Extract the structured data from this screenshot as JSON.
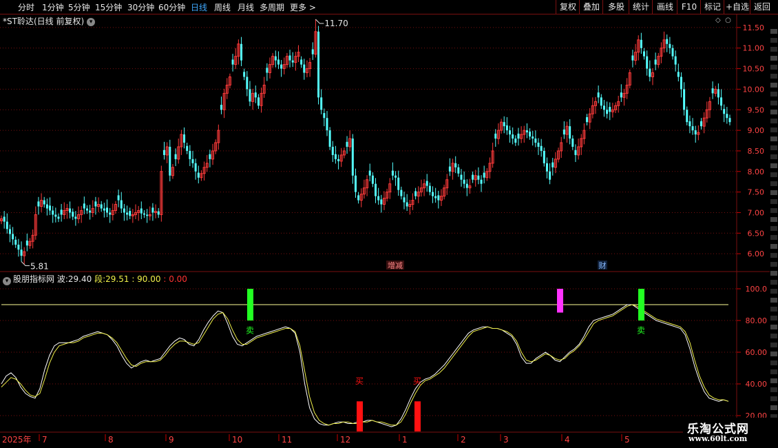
{
  "toolbar": {
    "periods": [
      {
        "label": "分时",
        "active": false
      },
      {
        "label": "1分钟",
        "active": false
      },
      {
        "label": "5分钟",
        "active": false
      },
      {
        "label": "15分钟",
        "active": false
      },
      {
        "label": "30分钟",
        "active": false
      },
      {
        "label": "60分钟",
        "active": false
      },
      {
        "label": "日线",
        "active": true
      },
      {
        "label": "周线",
        "active": false
      },
      {
        "label": "月线",
        "active": false
      },
      {
        "label": "多周期",
        "active": false
      },
      {
        "label": "更多 >",
        "active": false
      }
    ],
    "buttons": [
      "复权",
      "叠加",
      "多股",
      "统计",
      "画线",
      "F10",
      "标记",
      "+自选",
      "返回"
    ]
  },
  "stock": {
    "title": "*ST聆达(日线 前复权)"
  },
  "price_axis": {
    "ticks": [
      "11.50",
      "11.00",
      "10.50",
      "10.00",
      "9.50",
      "9.00",
      "8.50",
      "8.00",
      "7.50",
      "7.00",
      "6.50",
      "6.00"
    ]
  },
  "annotations": {
    "high": "11.70",
    "low": "5.81",
    "event_tag_1": "增减",
    "event_tag_2": "财"
  },
  "indicator": {
    "name": "股朋指标网",
    "wave_label": "波:",
    "wave_value": "29.40",
    "seg_label": "段:",
    "seg_value": "29.51",
    "extra_value": ": 90.00",
    "extra_value2": ": 0.00",
    "axis_ticks": [
      "100.0",
      "80.00",
      "60.00",
      "40.00",
      "20.00"
    ],
    "buy_label": "买",
    "sell_label": "卖"
  },
  "date_axis": {
    "year": "2025年",
    "months": [
      "7",
      "8",
      "9",
      "10",
      "11",
      "12",
      "1",
      "2",
      "3",
      "4",
      "5"
    ]
  },
  "watermark": {
    "name": "乐淘公式网",
    "url": "www.60lt.com"
  },
  "colors": {
    "up": "#ff3b3b",
    "down": "#54ffff",
    "ind_white": "#ffffff",
    "ind_yellow": "#f0f04a",
    "buy": "#ff1111",
    "sell": "#22ff22",
    "warn": "#ff33ff",
    "grid": "#7a1010"
  },
  "chart_data": [
    {
      "type": "candlestick",
      "title": "*ST聆达(日线 前复权)",
      "ylim": [
        5.6,
        11.8
      ],
      "y_ticks": [
        6.0,
        6.5,
        7.0,
        7.5,
        8.0,
        8.5,
        9.0,
        9.5,
        10.0,
        10.5,
        11.0,
        11.5
      ],
      "x_months": [
        "7",
        "8",
        "9",
        "10",
        "11",
        "12",
        "1",
        "2",
        "3",
        "4",
        "5"
      ],
      "annotations": [
        {
          "text": "11.70",
          "value": 11.7
        },
        {
          "text": "5.81",
          "value": 5.81
        }
      ],
      "close_series": [
        6.85,
        6.78,
        6.6,
        6.48,
        6.35,
        6.22,
        6.1,
        5.95,
        6.05,
        6.2,
        6.3,
        6.45,
        6.95,
        7.15,
        7.3,
        7.2,
        7.1,
        7.05,
        6.95,
        6.9,
        6.85,
        6.95,
        7.05,
        7.1,
        7.0,
        6.9,
        6.85,
        6.95,
        7.05,
        7.1,
        7.05,
        7.0,
        7.1,
        7.15,
        7.2,
        7.1,
        7.05,
        7.0,
        6.95,
        7.05,
        7.2,
        7.3,
        7.1,
        7.0,
        6.95,
        6.92,
        6.95,
        7.0,
        7.05,
        6.98,
        6.95,
        6.92,
        6.95,
        7.0,
        7.03,
        6.95,
        8.0,
        8.4,
        8.6,
        7.9,
        8.1,
        8.3,
        8.6,
        8.9,
        8.7,
        8.5,
        8.3,
        8.2,
        8.0,
        7.85,
        7.95,
        8.1,
        8.2,
        8.3,
        8.5,
        8.7,
        9.0,
        9.5,
        9.9,
        10.1,
        10.3,
        10.6,
        10.8,
        11.1,
        10.7,
        10.3,
        10.0,
        9.7,
        9.9,
        9.8,
        9.6,
        9.9,
        10.1,
        10.4,
        10.6,
        10.8,
        10.7,
        10.6,
        10.5,
        10.6,
        10.8,
        10.7,
        10.65,
        10.8,
        10.9,
        10.6,
        10.4,
        10.5,
        10.65,
        10.85,
        11.4,
        9.8,
        9.5,
        9.3,
        9.0,
        8.6,
        8.4,
        8.3,
        8.25,
        8.4,
        8.5,
        8.6,
        8.8,
        7.9,
        7.5,
        7.3,
        7.45,
        7.6,
        7.8,
        7.9,
        7.7,
        7.4,
        7.3,
        7.2,
        7.35,
        7.5,
        7.7,
        7.9,
        7.85,
        7.55,
        7.4,
        7.25,
        7.15,
        7.2,
        7.3,
        7.4,
        7.5,
        7.6,
        7.7,
        7.65,
        7.5,
        7.4,
        7.35,
        7.3,
        7.4,
        7.6,
        7.8,
        8.0,
        8.2,
        8.1,
        7.95,
        7.8,
        7.7,
        7.6,
        7.65,
        7.8,
        7.9,
        7.8,
        7.7,
        7.85,
        8.0,
        8.2,
        8.5,
        8.8,
        9.0,
        9.2,
        9.1,
        9.0,
        8.9,
        8.8,
        8.7,
        8.8,
        8.9,
        9.0,
        8.95,
        8.85,
        8.8,
        8.7,
        8.6,
        8.5,
        8.2,
        8.0,
        7.8,
        8.1,
        8.3,
        8.5,
        8.7,
        8.9,
        9.1,
        8.8,
        8.6,
        8.4,
        8.6,
        8.8,
        9.0,
        9.2,
        9.4,
        9.6,
        9.7,
        9.8,
        9.6,
        9.5,
        9.4,
        9.45,
        9.5,
        9.6,
        9.7,
        9.8,
        9.9,
        10.1,
        10.4,
        10.7,
        10.9,
        11.2,
        11.0,
        10.8,
        10.5,
        10.3,
        10.4,
        10.6,
        10.8,
        11.0,
        11.2,
        11.1,
        11.0,
        10.8,
        10.6,
        10.3,
        10.0,
        9.5,
        9.2,
        9.1,
        9.0,
        8.9,
        8.95,
        9.1,
        9.3,
        9.5,
        9.7,
        9.9,
        10.0,
        9.8,
        9.6,
        9.4,
        9.3,
        9.2
      ]
    },
    {
      "type": "line",
      "title": "股朋指标网",
      "ylim": [
        10,
        110
      ],
      "y_ticks": [
        20,
        40,
        60,
        80,
        100
      ],
      "reference_line": 90,
      "series": [
        {
          "name": "波",
          "last": 29.4,
          "values": [
            40,
            45,
            47,
            44,
            38,
            34,
            32,
            31,
            37,
            49,
            58,
            64,
            66,
            66,
            66,
            67,
            68,
            70,
            71,
            72,
            73,
            72,
            71,
            68,
            64,
            58,
            53,
            50,
            52,
            54,
            55,
            54,
            55,
            56,
            60,
            64,
            67,
            69,
            68,
            65,
            64,
            68,
            74,
            79,
            83,
            86,
            85,
            78,
            70,
            65,
            64,
            66,
            68,
            70,
            71,
            72,
            73,
            74,
            75,
            76,
            75,
            72,
            60,
            40,
            25,
            18,
            15,
            14,
            14,
            15,
            16,
            16,
            15,
            15,
            16,
            16,
            17,
            17,
            16,
            15,
            14,
            13,
            14,
            18,
            24,
            31,
            37,
            41,
            43,
            44,
            46,
            49,
            52,
            56,
            60,
            64,
            68,
            72,
            74,
            75,
            76,
            76,
            75,
            75,
            74,
            72,
            70,
            65,
            57,
            53,
            53,
            56,
            58,
            60,
            58,
            55,
            54,
            57,
            60,
            62,
            65,
            70,
            76,
            80,
            81,
            82,
            83,
            84,
            86,
            88,
            90,
            90,
            88,
            86,
            84,
            82,
            80,
            79,
            78,
            77,
            76,
            75,
            71,
            62,
            51,
            42,
            35,
            31,
            30,
            29,
            30,
            29
          ]
        },
        {
          "name": "段",
          "last": 29.51,
          "values": [
            38,
            41,
            44,
            43,
            40,
            36,
            33,
            32,
            34,
            43,
            53,
            60,
            64,
            65,
            66,
            66,
            67,
            69,
            70,
            71,
            72,
            72,
            71,
            69,
            66,
            61,
            56,
            52,
            51,
            53,
            54,
            54,
            54,
            55,
            58,
            62,
            65,
            67,
            67,
            66,
            65,
            66,
            71,
            76,
            81,
            84,
            85,
            81,
            74,
            68,
            65,
            65,
            67,
            69,
            70,
            71,
            72,
            73,
            74,
            75,
            75,
            73,
            64,
            48,
            32,
            22,
            17,
            15,
            14,
            15,
            15,
            16,
            16,
            15,
            15,
            16,
            16,
            17,
            16,
            16,
            15,
            14,
            14,
            16,
            21,
            28,
            34,
            39,
            42,
            43,
            45,
            47,
            50,
            54,
            58,
            62,
            66,
            70,
            73,
            74,
            75,
            76,
            75,
            75,
            74,
            73,
            71,
            67,
            60,
            55,
            54,
            55,
            57,
            59,
            58,
            56,
            55,
            56,
            59,
            61,
            64,
            68,
            73,
            78,
            80,
            81,
            82,
            83,
            85,
            87,
            89,
            90,
            89,
            87,
            85,
            83,
            81,
            80,
            79,
            78,
            77,
            76,
            73,
            66,
            55,
            45,
            38,
            33,
            31,
            30,
            30,
            29
          ]
        }
      ],
      "signals": [
        {
          "type": "sell",
          "label": "卖",
          "month": "10"
        },
        {
          "type": "buy",
          "label": "买",
          "month": "12"
        },
        {
          "type": "buy",
          "label": "买",
          "month": "1"
        },
        {
          "type": "warn",
          "label": "",
          "month": "4"
        },
        {
          "type": "sell",
          "label": "卖",
          "month": "5"
        }
      ]
    }
  ]
}
